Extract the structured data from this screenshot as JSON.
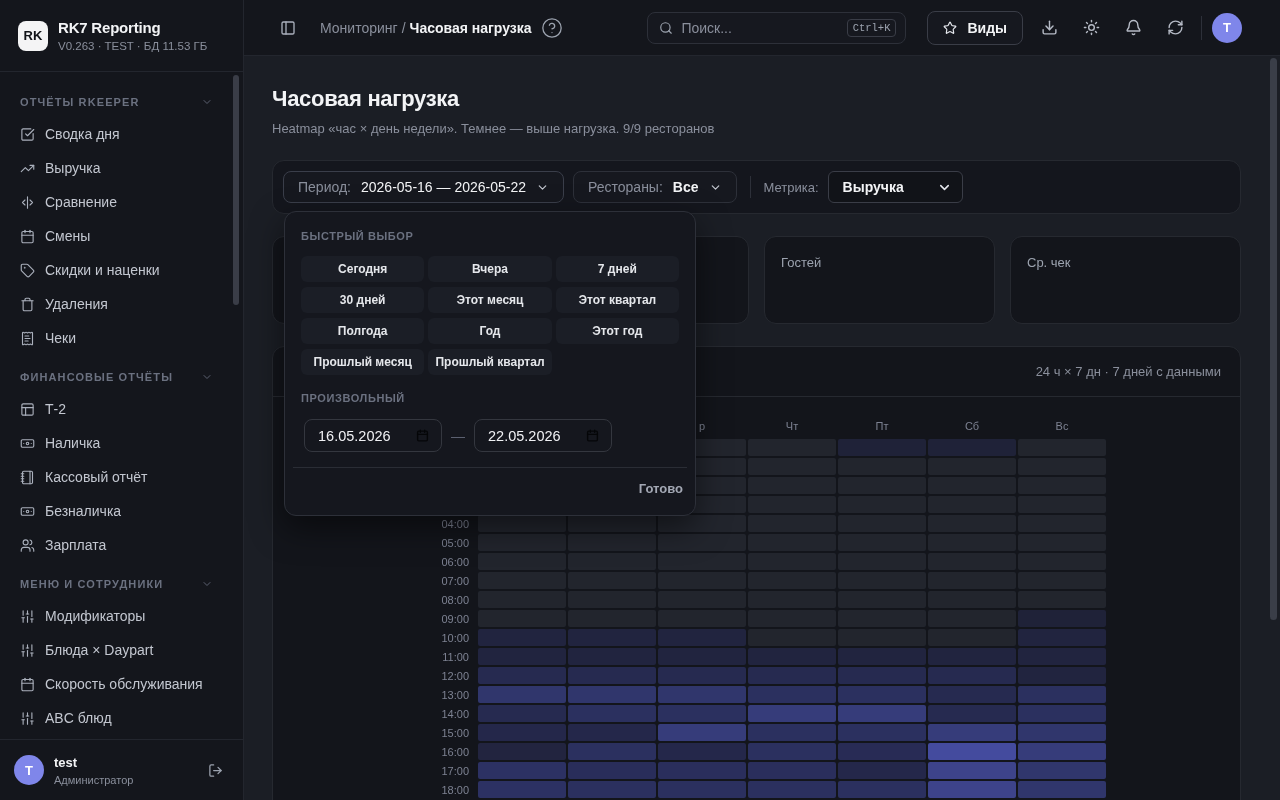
{
  "sidebar": {
    "logo": "RK",
    "app_name": "RK7 Reporting",
    "meta": "V0.263 · TEST · БД 11.53 ГБ",
    "sections": [
      {
        "title": "ОТЧЁТЫ RKEEPER",
        "expanded": true,
        "items": [
          "Сводка дня",
          "Выручка",
          "Сравнение",
          "Смены",
          "Скидки и наценки",
          "Удаления",
          "Чеки"
        ]
      },
      {
        "title": "ФИНАНСОВЫЕ ОТЧЁТЫ",
        "expanded": true,
        "items": [
          "Т-2",
          "Наличка",
          "Кассовый отчёт",
          "Безналичка",
          "Зарплата"
        ]
      },
      {
        "title": "МЕНЮ И СОТРУДНИКИ",
        "expanded": true,
        "items": [
          "Модификаторы",
          "Блюда × Daypart",
          "Скорость обслуживания",
          "ABC блюд"
        ]
      }
    ],
    "user": {
      "initial": "T",
      "name": "test",
      "role": "Администратор"
    }
  },
  "header": {
    "breadcrumb": {
      "parent": "Мониторинг",
      "separator": "/",
      "current": "Часовая нагрузка"
    },
    "search": {
      "placeholder": "Поиск...",
      "shortcut": "Ctrl+K"
    },
    "views_button": "Виды",
    "avatar": "T"
  },
  "page": {
    "title": "Часовая нагрузка",
    "subtitle": "Heatmap «час × день недели». Темнее — выше нагрузка. 9/9 ресторанов"
  },
  "filters": {
    "period": {
      "label": "Период:",
      "value": "2026-05-16 — 2026-05-22",
      "open": true
    },
    "restaurants": {
      "label": "Рестораны:",
      "value": "Все"
    },
    "metric": {
      "label": "Метрика:",
      "value": "Выручка"
    }
  },
  "period_popup": {
    "quick_title": "БЫСТРЫЙ ВЫБОР",
    "presets": [
      "Сегодня",
      "Вчера",
      "7 дней",
      "30 дней",
      "Этот месяц",
      "Этот квартал",
      "Полгода",
      "Год",
      "Этот год",
      "Прошлый месяц",
      "Прошлый квартал"
    ],
    "custom_title": "ПРОИЗВОЛЬНЫЙ",
    "date_from": "16.05.2026",
    "range_separator": "—",
    "date_to": "22.05.2026",
    "done_button": "Готово"
  },
  "kpi_cards": [
    {
      "label": "Гостей"
    },
    {
      "label": "Ср. чек"
    }
  ],
  "heatmap": {
    "summary": "24 ч × 7 дн · 7 дней с данными",
    "days": [
      "р",
      "Чт",
      "Пт",
      "Сб",
      "Вс"
    ],
    "rows": [
      {
        "cells": [
          null,
          null,
          {
            "color": "#22252d"
          },
          {
            "color": "#22252d"
          },
          {
            "color": "#1f2238"
          },
          {
            "color": "#1f2238"
          },
          {
            "color": "#22252d"
          }
        ]
      },
      {
        "cells": [
          null,
          null,
          {
            "color": "#22252d"
          },
          {
            "color": "#22252d"
          },
          {
            "color": "#22252d"
          },
          {
            "color": "#22252d"
          },
          {
            "color": "#22252d"
          }
        ]
      },
      {
        "cells": [
          null,
          null,
          {
            "color": "#22252d"
          },
          {
            "color": "#22252d"
          },
          {
            "color": "#22252d"
          },
          {
            "color": "#22252d"
          },
          {
            "color": "#22252d"
          }
        ]
      },
      {
        "cells": [
          null,
          null,
          {
            "color": "#22252d"
          },
          {
            "color": "#22252d"
          },
          {
            "color": "#22252d"
          },
          {
            "color": "#22252d"
          },
          {
            "color": "#22252d"
          }
        ]
      },
      {
        "hour": "04:00",
        "cells": [
          {
            "color": "#22252d"
          },
          {
            "color": "#22252d"
          },
          {
            "color": "#22252d"
          },
          {
            "color": "#22252d"
          },
          {
            "color": "#22252d"
          },
          {
            "color": "#22252d"
          },
          {
            "color": "#22252d"
          }
        ]
      },
      {
        "hour": "05:00",
        "cells": [
          {
            "color": "#22252d"
          },
          {
            "color": "#22252d"
          },
          {
            "color": "#22252d"
          },
          {
            "color": "#22252d"
          },
          {
            "color": "#22252d"
          },
          {
            "color": "#22252d"
          },
          {
            "color": "#22252d"
          }
        ]
      },
      {
        "hour": "06:00",
        "cells": [
          {
            "color": "#22252d"
          },
          {
            "color": "#22252d"
          },
          {
            "color": "#22252d"
          },
          {
            "color": "#22252d"
          },
          {
            "color": "#22252d"
          },
          {
            "color": "#22252d"
          },
          {
            "color": "#22252d"
          }
        ]
      },
      {
        "hour": "07:00",
        "cells": [
          {
            "color": "#22252d"
          },
          {
            "color": "#22252d"
          },
          {
            "color": "#22252d"
          },
          {
            "color": "#22252d"
          },
          {
            "color": "#22252d"
          },
          {
            "color": "#22252d"
          },
          {
            "color": "#22252d"
          }
        ]
      },
      {
        "hour": "08:00",
        "cells": [
          {
            "color": "#22252d"
          },
          {
            "color": "#22252d"
          },
          {
            "color": "#22252d"
          },
          {
            "color": "#22252d"
          },
          {
            "color": "#22252d"
          },
          {
            "color": "#22252d"
          },
          {
            "color": "#22252d"
          }
        ]
      },
      {
        "hour": "09:00",
        "cells": [
          {
            "color": "#22252d"
          },
          {
            "color": "#22252d"
          },
          {
            "color": "#22252d"
          },
          {
            "color": "#22252d"
          },
          {
            "color": "#22252d"
          },
          {
            "color": "#22252d"
          },
          {
            "color": "#1f2238"
          }
        ]
      },
      {
        "hour": "10:00",
        "cells": [
          {
            "color": "#21243f"
          },
          {
            "color": "#21243f"
          },
          {
            "color": "#21243f"
          },
          {
            "color": "#22252d"
          },
          {
            "color": "#22252d"
          },
          {
            "color": "#22252d"
          },
          {
            "color": "#21243f"
          }
        ]
      },
      {
        "hour": "11:00",
        "cells": [
          {
            "color": "#21243f"
          },
          {
            "color": "#21243f"
          },
          {
            "color": "#21243f"
          },
          {
            "color": "#21243f"
          },
          {
            "color": "#21243f"
          },
          {
            "color": "#21243f"
          },
          {
            "color": "#21243f"
          }
        ]
      },
      {
        "hour": "12:00",
        "cells": [
          {
            "color": "#262a50"
          },
          {
            "color": "#262a50"
          },
          {
            "color": "#262a50"
          },
          {
            "color": "#262a50"
          },
          {
            "color": "#262a50"
          },
          {
            "color": "#262a50"
          },
          {
            "color": "#21243f"
          }
        ]
      },
      {
        "hour": "13:00",
        "cells": [
          {
            "color": "#30366c"
          },
          {
            "color": "#30366c"
          },
          {
            "color": "#30366c"
          },
          {
            "color": "#2b305f"
          },
          {
            "color": "#2b305f"
          },
          {
            "color": "#262a50"
          },
          {
            "color": "#2b305f"
          }
        ]
      },
      {
        "hour": "14:00",
        "cells": [
          {
            "color": "#262a50"
          },
          {
            "color": "#2b305f"
          },
          {
            "color": "#2b305f"
          },
          {
            "color": "#363c7a"
          },
          {
            "color": "#363c7a"
          },
          {
            "color": "#262a50"
          },
          {
            "color": "#2b305f"
          }
        ]
      },
      {
        "hour": "15:00",
        "cells": [
          {
            "color": "#24274a"
          },
          {
            "color": "#24274a"
          },
          {
            "color": "#363c7a"
          },
          {
            "color": "#2b305f"
          },
          {
            "color": "#2b305f"
          },
          {
            "color": "#363c7a"
          },
          {
            "color": "#30366c"
          }
        ]
      },
      {
        "hour": "16:00",
        "cells": [
          {
            "color": "#22243f"
          },
          {
            "color": "#2b305f"
          },
          {
            "color": "#24274a"
          },
          {
            "color": "#2b305f"
          },
          {
            "color": "#282b55"
          },
          {
            "color": "#444b9e"
          },
          {
            "color": "#363c7a"
          }
        ]
      },
      {
        "hour": "17:00",
        "cells": [
          {
            "color": "#2c3163"
          },
          {
            "color": "#292d5a"
          },
          {
            "color": "#2a2e5c"
          },
          {
            "color": "#2a2e5c"
          },
          {
            "color": "#24274a"
          },
          {
            "color": "#3d438a"
          },
          {
            "color": "#30366c"
          }
        ]
      },
      {
        "hour": "18:00",
        "cells": [
          {
            "color": "#2c3163"
          },
          {
            "color": "#2b305f"
          },
          {
            "color": "#2b305f"
          },
          {
            "color": "#2b305f"
          },
          {
            "color": "#2b305f"
          },
          {
            "color": "#3d438a"
          },
          {
            "color": "#30366c"
          }
        ]
      }
    ]
  }
}
